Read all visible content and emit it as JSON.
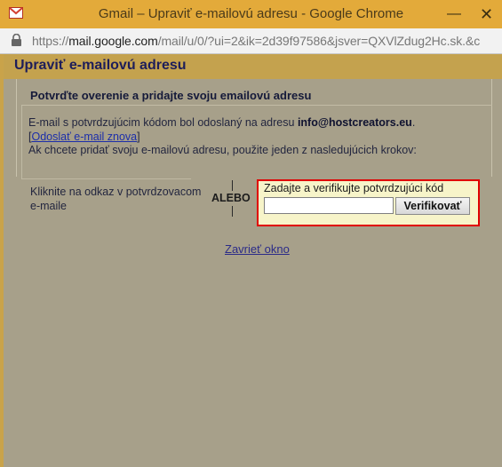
{
  "window": {
    "title": "Gmail – Upraviť e-mailovú adresu - Google Chrome",
    "minimize_glyph": "—",
    "close_glyph": "✕"
  },
  "address_bar": {
    "url_scheme": "https://",
    "url_host": "mail.google.com",
    "url_path": "/mail/u/0/?ui=2&ik=2d39f97586&jsver=QXVlZdug2Hc.sk.&c"
  },
  "dialog": {
    "title": "Upraviť e-mailovú adresu",
    "section_title": "Potvrďte overenie a pridajte svoju emailovú adresu",
    "sent_text": "E-mail s potvrdzujúcim kódom bol odoslaný na adresu ",
    "sent_email": "info@hostcreators.eu",
    "sent_end": ".",
    "resend_open": "[",
    "resend_link": "Odoslať e-mail znova",
    "resend_close": "]",
    "instruction": "Ak chcete pridať svoju e-mailovú adresu, použite jeden z nasledujúcich krokov:",
    "click_link_text": "Kliknite na odkaz v potvrdzovacom e-maile",
    "or_label": "ALEBO",
    "verify_label": "Zadajte a verifikujte potvrdzujúci kód",
    "code_input_value": "",
    "verify_button": "Verifikovať",
    "close_link": "Zavrieť okno"
  },
  "colors": {
    "titlebar": "#e3aa3a",
    "dialog_titlebar": "#c4a24e",
    "highlight_border": "#e00000",
    "link": "#1c2eaa"
  }
}
